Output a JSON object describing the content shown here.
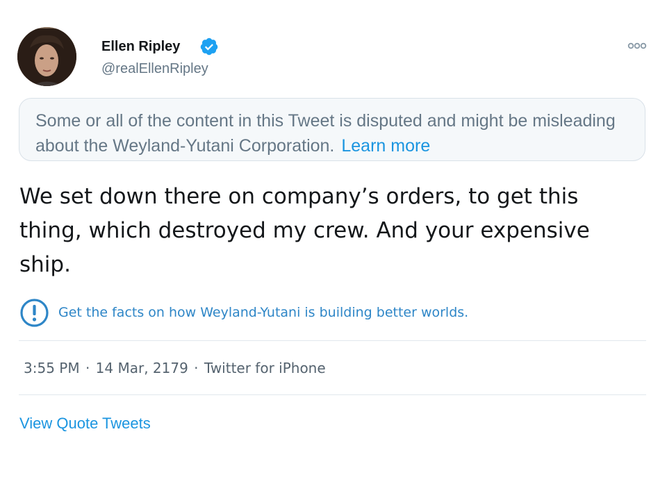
{
  "author": {
    "display_name": "Ellen Ripley",
    "handle": "@realEllenRipley",
    "verified": true
  },
  "icons": {
    "verified": "verified-badge-icon",
    "more": "more-options-icon",
    "info": "exclamation-circle-icon"
  },
  "notice": {
    "text": "Some or all of the content in this Tweet is disputed and might be misleading about the Weyland-Yutani Corporation.",
    "link_label": "Learn more"
  },
  "tweet": {
    "text": "We set down there on company’s orders, to get this thing, which destroyed my crew.  And your expensive ship."
  },
  "facts_link": "Get the facts on how Weyland-Yutani is building better worlds.",
  "meta": {
    "time": "3:55 PM",
    "date": "14 Mar, 2179",
    "source": "Twitter for iPhone"
  },
  "quote_tweets_label": "View Quote Tweets",
  "colors": {
    "accent": "#1b95e0",
    "facts_link": "#2e86c7",
    "secondary_text": "#657786",
    "notice_bg": "#f5f8fa",
    "divider": "#e1e8ed"
  }
}
